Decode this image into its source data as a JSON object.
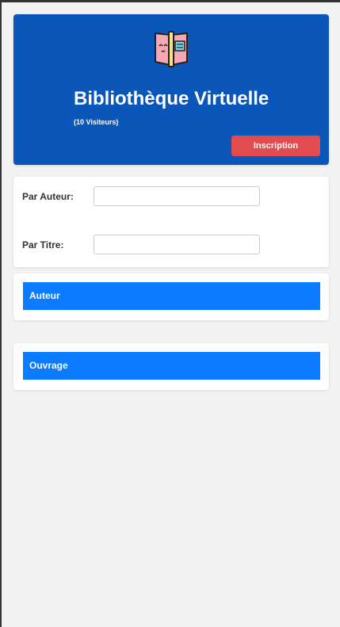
{
  "header": {
    "title": "Bibliothèque Virtuelle",
    "visitors": "(10 Visiteurs)",
    "signup_label": "Inscription",
    "logo_icon": "book-icon",
    "colors": {
      "background": "#0b56b9",
      "button": "#e24b4f"
    }
  },
  "search": {
    "author_label": "Par Auteur:",
    "author_value": "",
    "title_label": "Par Titre:",
    "title_value": ""
  },
  "sections": {
    "author": "Auteur",
    "work": "Ouvrage",
    "bar_color": "#0b7bff"
  }
}
